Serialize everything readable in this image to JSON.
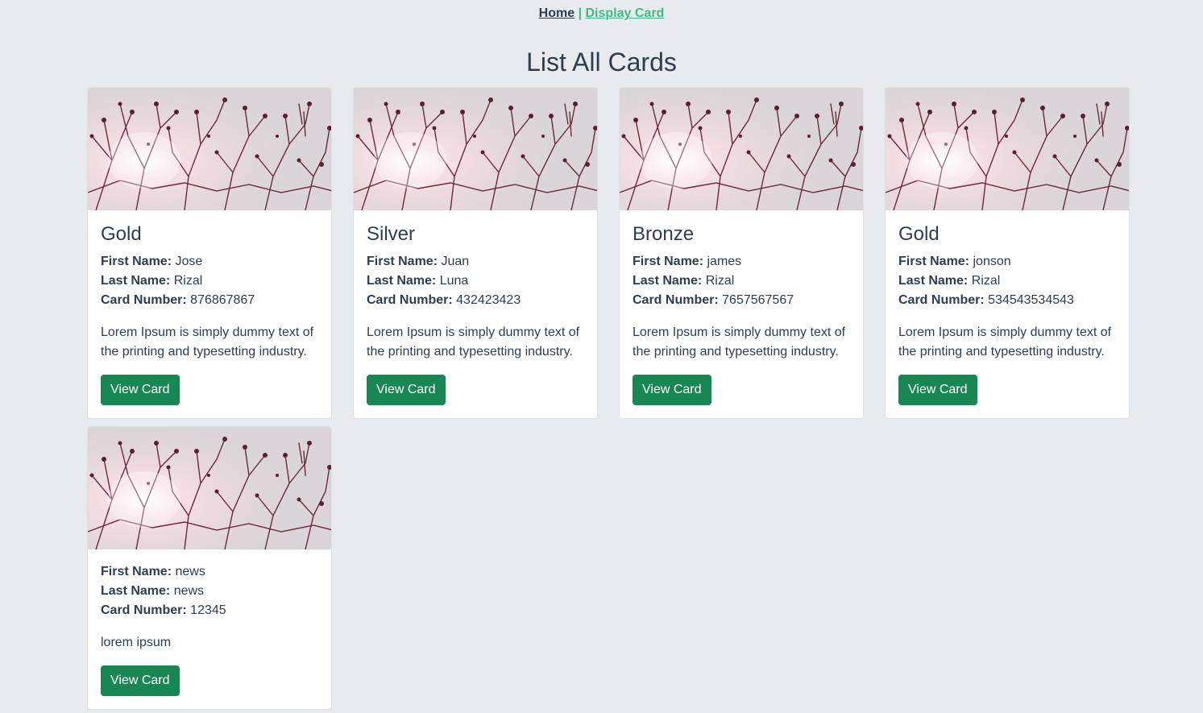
{
  "nav": {
    "home_label": "Home",
    "separator": " | ",
    "display_label": "Display Card"
  },
  "page_title": "List All Cards",
  "labels": {
    "first_name": "First Name:",
    "last_name": "Last Name:",
    "card_number": "Card Number:",
    "view_button": "View Card"
  },
  "image": {
    "description": "branches-silhouette-photo"
  },
  "colors": {
    "background": "#e8ebee",
    "text": "#2c3e50",
    "nav_active": "#42b983",
    "button": "#198754"
  },
  "cards": [
    {
      "title": "Gold",
      "first_name": "Jose",
      "last_name": "Rizal",
      "card_number": "876867867",
      "description": "Lorem Ipsum is simply dummy text of the printing and typesetting industry."
    },
    {
      "title": "Silver",
      "first_name": "Juan",
      "last_name": "Luna",
      "card_number": "432423423",
      "description": "Lorem Ipsum is simply dummy text of the printing and typesetting industry."
    },
    {
      "title": "Bronze",
      "first_name": "james",
      "last_name": "Rizal",
      "card_number": "7657567567",
      "description": "Lorem Ipsum is simply dummy text of the printing and typesetting industry."
    },
    {
      "title": "Gold",
      "first_name": "jonson",
      "last_name": "Rizal",
      "card_number": "534543534543",
      "description": "Lorem Ipsum is simply dummy text of the printing and typesetting industry."
    },
    {
      "title": "",
      "first_name": "news",
      "last_name": "news",
      "card_number": "12345",
      "description": "lorem ipsum"
    }
  ]
}
